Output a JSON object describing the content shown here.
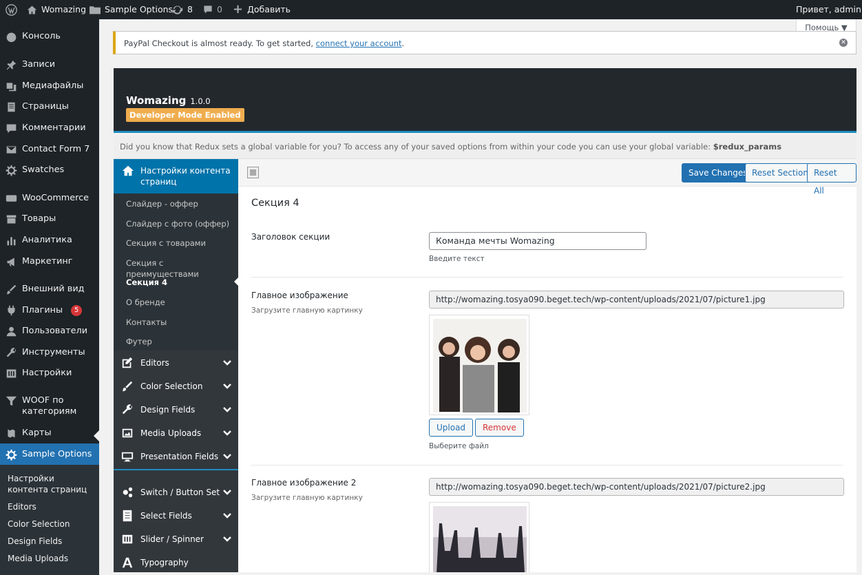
{
  "admin_bar": {
    "site_name": "Womazing",
    "options_page": "Sample Options",
    "updates_count": "8",
    "comments_count": "0",
    "add_label": "Добавить",
    "greeting": "Привет, admin"
  },
  "admin_menu": {
    "items": [
      {
        "label": "Консоль",
        "icon": "dashboard-icon"
      },
      {
        "label": "Записи",
        "icon": "pin-icon"
      },
      {
        "label": "Медиафайлы",
        "icon": "media-icon"
      },
      {
        "label": "Страницы",
        "icon": "page-icon"
      },
      {
        "label": "Комментарии",
        "icon": "comment-icon"
      },
      {
        "label": "Contact Form 7",
        "icon": "mail-icon"
      },
      {
        "label": "Swatches",
        "icon": "gear-icon"
      },
      {
        "label": "WooCommerce",
        "icon": "woo-icon"
      },
      {
        "label": "Товары",
        "icon": "archive-icon"
      },
      {
        "label": "Аналитика",
        "icon": "chart-icon"
      },
      {
        "label": "Маркетинг",
        "icon": "megaphone-icon"
      },
      {
        "label": "Внешний вид",
        "icon": "brush-icon"
      },
      {
        "label": "Плагины",
        "icon": "plug-icon",
        "badge": "5"
      },
      {
        "label": "Пользователи",
        "icon": "user-icon"
      },
      {
        "label": "Инструменты",
        "icon": "wrench-icon"
      },
      {
        "label": "Настройки",
        "icon": "sliders-icon"
      },
      {
        "label": "WOOF по категориям",
        "icon": "filter-icon"
      },
      {
        "label": "Карты",
        "icon": "map-icon"
      },
      {
        "label": "Sample Options",
        "icon": "gear-icon"
      }
    ],
    "submenu": [
      "Настройки контента страниц",
      "Editors",
      "Color Selection",
      "Design Fields",
      "Media Uploads"
    ]
  },
  "help_tab": "Помощь ▼",
  "notice": {
    "text": "PayPal Checkout is almost ready. To get started,",
    "link": "connect your account",
    "end": "."
  },
  "redux": {
    "title": "Womazing",
    "version": "1.0.0",
    "dev_badge": "Developer Mode Enabled",
    "info_text": "Did you know that Redux sets a global variable for you? To access any of your saved options from within your code you can use your global variable:",
    "info_var": "$redux_params",
    "sidebar": {
      "active_section": "Настройки контента страниц",
      "subsections": [
        "Слайдер - оффер",
        "Слайдер с фото (оффер)",
        "Секция с товарами",
        "Секция с преимуществами",
        "Секция 4",
        "О бренде",
        "Контакты",
        "Футер"
      ],
      "sections": [
        {
          "label": "Editors",
          "icon": "edit-icon"
        },
        {
          "label": "Color Selection",
          "icon": "brush-icon"
        },
        {
          "label": "Design Fields",
          "icon": "wrench-icon"
        },
        {
          "label": "Media Uploads",
          "icon": "image-icon"
        },
        {
          "label": "Presentation Fields",
          "icon": "monitor-icon"
        }
      ],
      "sections2": [
        {
          "label": "Switch / Button Set",
          "icon": "cogs-icon"
        },
        {
          "label": "Select Fields",
          "icon": "list-icon"
        },
        {
          "label": "Slider / Spinner",
          "icon": "sliders-icon"
        },
        {
          "label": "Typography",
          "icon": "font-icon"
        }
      ]
    },
    "buttons": {
      "save": "Save Changes",
      "reset_section": "Reset Section",
      "reset_all": "Reset All"
    },
    "section_title": "Секция 4",
    "fields": {
      "heading": {
        "label": "Заголовок секции",
        "value": "Команда мечты Womazing",
        "hint": "Введите текст"
      },
      "image1": {
        "label": "Главное изображение",
        "desc": "Загрузите главную картинку",
        "url": "http://womazing.tosya090.beget.tech/wp-content/uploads/2021/07/picture1.jpg",
        "upload": "Upload",
        "remove": "Remove",
        "hint": "Выберите файл"
      },
      "image2": {
        "label": "Главное изображение 2",
        "desc": "Загрузите главную картинку",
        "url": "http://womazing.tosya090.beget.tech/wp-content/uploads/2021/07/picture2.jpg"
      }
    }
  }
}
